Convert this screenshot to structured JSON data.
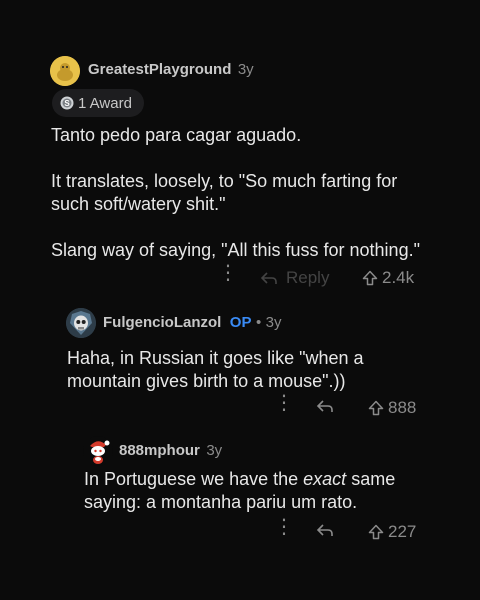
{
  "comments": [
    {
      "username": "GreatestPlayground",
      "age": "3y",
      "award": {
        "icon": "silver-award-icon",
        "label": "1 Award"
      },
      "body": [
        "Tanto pedo para cagar aguado.",
        "It translates, loosely, to \"So much farting for",
        "such soft/watery shit.\"",
        "Slang way of saying, \"All this fuss for nothing.\""
      ],
      "actions": {
        "reply_label": "Reply",
        "score": "2.4k"
      }
    },
    {
      "username": "FulgencioLanzol",
      "op_badge": "OP",
      "separator": "•",
      "age": "3y",
      "body": [
        "Haha, in Russian it goes like \"when a",
        "mountain gives birth to a mouse\".))"
      ],
      "actions": {
        "score": "888"
      }
    },
    {
      "username": "888mphour",
      "age": "3y",
      "body_line1": {
        "before": "In Portuguese we have the ",
        "em": "exact",
        "after": " same"
      },
      "body_line2": "saying: a montanha pariu um rato.",
      "actions": {
        "score": "227"
      }
    }
  ],
  "colors": {
    "op": "#3a8bf5",
    "background": "#0b0b0b"
  }
}
